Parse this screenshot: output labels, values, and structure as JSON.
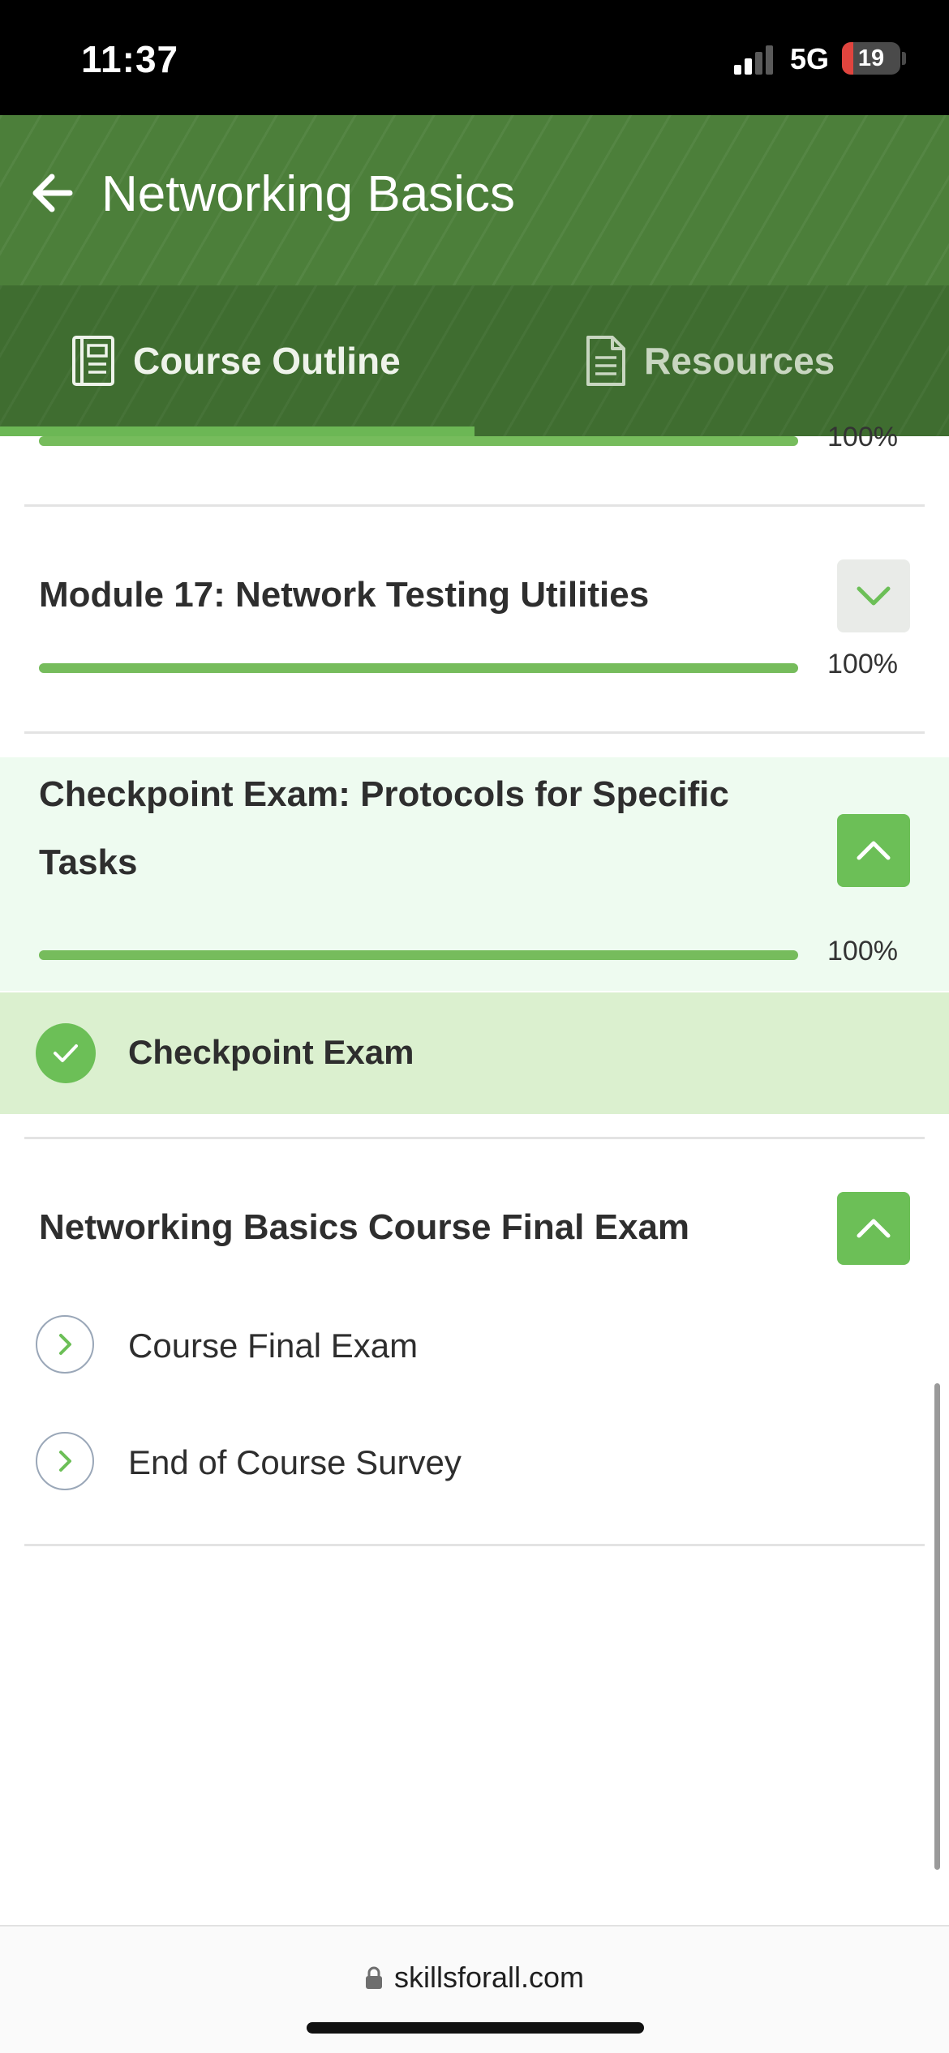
{
  "status_bar": {
    "time": "11:37",
    "network": "5G",
    "battery": "19",
    "battery_level": 0.19,
    "signal_bars_active": 2,
    "signal_bars_total": 4
  },
  "header": {
    "title": "Networking Basics",
    "back_icon": "arrow-left-icon"
  },
  "tabs": [
    {
      "label": "Course Outline",
      "icon": "book-outline-icon",
      "active": true
    },
    {
      "label": "Resources",
      "icon": "document-icon",
      "active": false
    }
  ],
  "modules": [
    {
      "title": "",
      "progress_label": "100%",
      "progress": 1.0
    },
    {
      "title": "Module 17: Network Testing Utilities",
      "progress_label": "100%",
      "progress": 1.0,
      "expanded": false
    },
    {
      "title": "Checkpoint Exam: Protocols for Specific Tasks",
      "progress_label": "100%",
      "progress": 1.0,
      "expanded": true,
      "items": [
        {
          "label": "Checkpoint Exam",
          "completed": true
        }
      ]
    },
    {
      "title": "Networking Basics Course Final Exam",
      "expanded": true,
      "items": [
        {
          "label": "Course Final Exam",
          "completed": false
        },
        {
          "label": "End of Course Survey",
          "completed": false
        }
      ]
    }
  ],
  "browser": {
    "url": "skillsforall.com",
    "lock_icon": "lock-icon"
  },
  "colors": {
    "header_green": "#4c7f3a",
    "tab_bar_green": "#3f6d30",
    "progress_green": "#76bc5c",
    "accent_green": "#6cbf57",
    "completed_row_bg": "#dbf0cf",
    "expanded_section_bg": "#eefbf0"
  }
}
